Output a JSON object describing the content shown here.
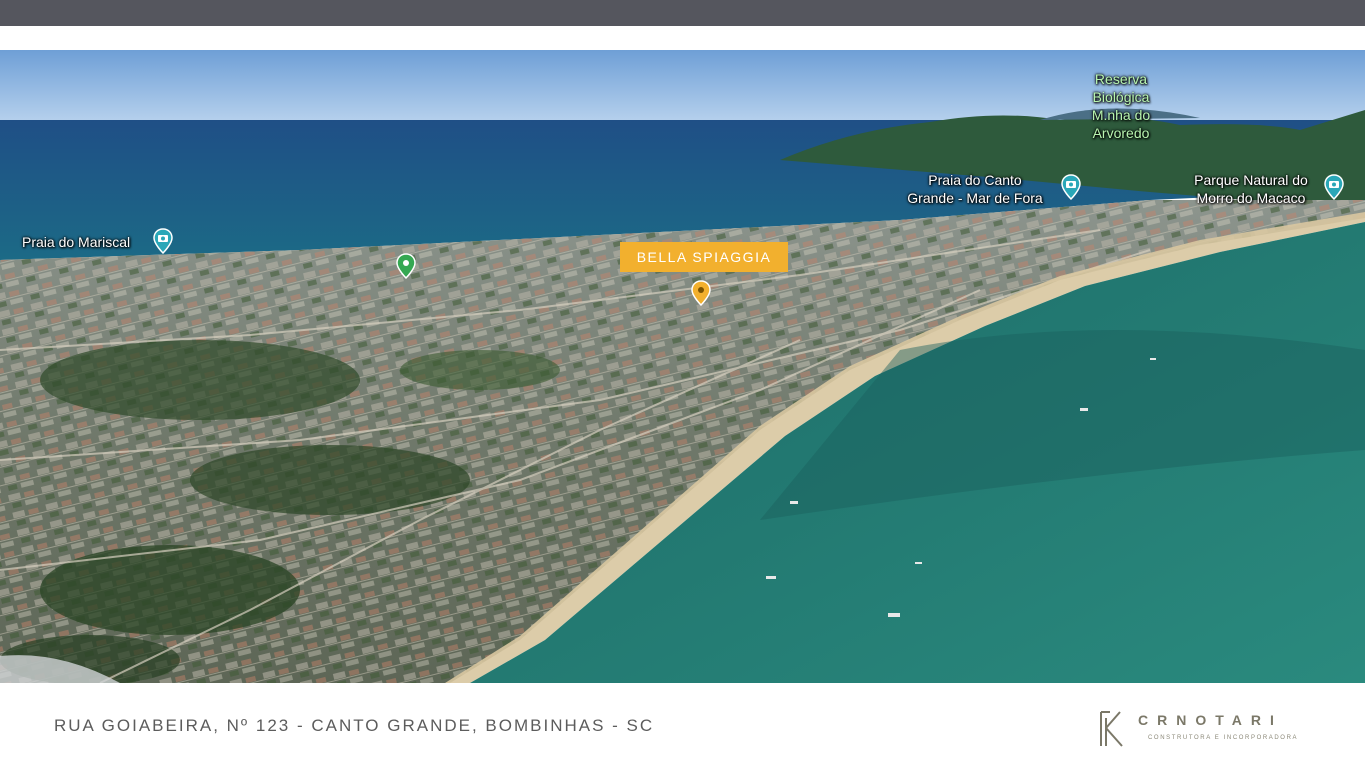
{
  "map": {
    "labels": {
      "reserva": "Reserva\nBiológica\nM.nha do\nArvoredo",
      "praia_canto_grande": "Praia do Canto\nGrande - Mar de Fora",
      "parque_natural": "Parque Natural do\nMorro do Macaco",
      "praia_mariscal": "Praia do Mariscal"
    },
    "property_tag": "BELLA SPIAGGIA",
    "icons": [
      "camera-pin-icon",
      "green-pin-icon",
      "yellow-pin-icon"
    ],
    "colors": {
      "tag": "#f2b02e",
      "poi_pin": "#2aa7b8",
      "green_pin": "#35a852",
      "yellow_pin": "#f2b02e"
    }
  },
  "footer": {
    "address": "RUA GOIABEIRA, Nº 123 - CANTO GRANDE, BOMBINHAS - SC",
    "logo_name": "CRNOTARI",
    "logo_subtitle": "CONSTRUTORA E INCORPORADORA"
  }
}
